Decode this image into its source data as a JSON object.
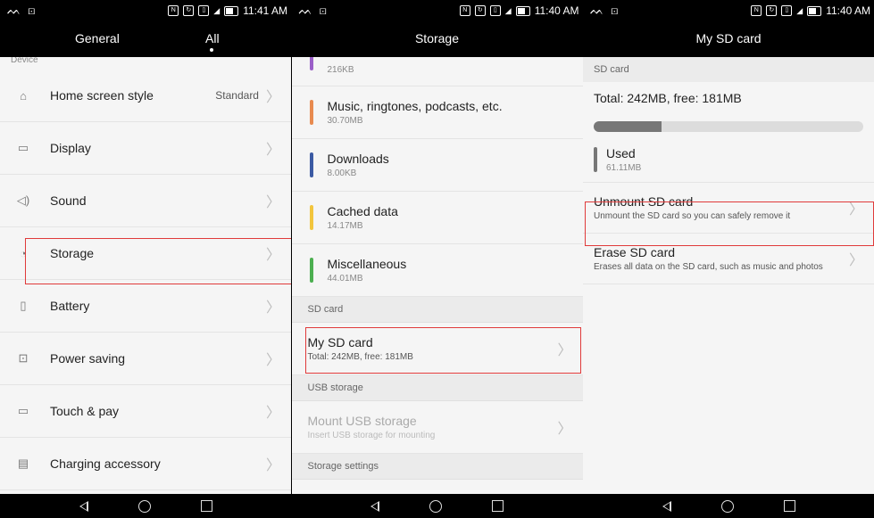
{
  "panels": [
    {
      "status": {
        "left": "ᨓ ⊡",
        "time": "11:41 AM"
      },
      "tabs": {
        "general": "General",
        "all": "All"
      },
      "section_label": "Device",
      "items": [
        {
          "icon": "⌂",
          "label": "Home screen style",
          "value": "Standard"
        },
        {
          "icon": "▭",
          "label": "Display",
          "value": ""
        },
        {
          "icon": "◁)",
          "label": "Sound",
          "value": ""
        },
        {
          "icon": "◔",
          "label": "Storage",
          "value": ""
        },
        {
          "icon": "▯",
          "label": "Battery",
          "value": ""
        },
        {
          "icon": "⊡",
          "label": "Power saving",
          "value": ""
        },
        {
          "icon": "▭",
          "label": "Touch & pay",
          "value": ""
        },
        {
          "icon": "▤",
          "label": "Charging accessory",
          "value": ""
        }
      ]
    },
    {
      "status": {
        "left": "ᨓ ⊡",
        "time": "11:40 AM"
      },
      "title": "Storage",
      "top_partial": {
        "sub": "216KB",
        "color": "#9b5fc8"
      },
      "categories": [
        {
          "label": "Music, ringtones, podcasts, etc.",
          "sub": "30.70MB",
          "color": "#e88a4f"
        },
        {
          "label": "Downloads",
          "sub": "8.00KB",
          "color": "#3b5aa3"
        },
        {
          "label": "Cached data",
          "sub": "14.17MB",
          "color": "#f2c53d"
        },
        {
          "label": "Miscellaneous",
          "sub": "44.01MB",
          "color": "#4caf50"
        }
      ],
      "sd_header": "SD card",
      "sd_item": {
        "label": "My SD card",
        "sub": "Total: 242MB, free: 181MB"
      },
      "usb_header": "USB storage",
      "usb_item": {
        "label": "Mount USB storage",
        "sub": "Insert USB storage for mounting"
      },
      "settings_header": "Storage settings"
    },
    {
      "status": {
        "left": "ᨓ ⊡",
        "time": "11:40 AM"
      },
      "title": "My SD card",
      "header": "SD card",
      "total": "Total: 242MB, free: 181MB",
      "used_fraction": 0.25,
      "used": {
        "label": "Used",
        "sub": "61.11MB"
      },
      "actions": [
        {
          "label": "Unmount SD card",
          "sub": "Unmount the SD card so you can safely remove it"
        },
        {
          "label": "Erase SD card",
          "sub": "Erases all data on the SD card, such as music and photos"
        }
      ]
    }
  ]
}
